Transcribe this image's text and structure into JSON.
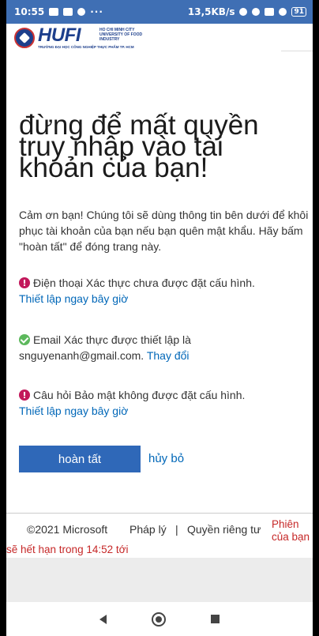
{
  "status_bar": {
    "time": "10:55",
    "overflow": "···",
    "speed": "13,5KB/s",
    "battery": "91"
  },
  "header": {
    "logo_word": "HUFI",
    "logo_side": "HO CHI MINH CITY UNIVERSITY OF FOOD INDUSTRY",
    "logo_sub": "TRƯỜNG ĐẠI HỌC CÔNG NGHIỆP THỰC PHẨM TP. HCM"
  },
  "main": {
    "title": "đừng để mất quyền truy nhập vào tài khoản của bạn!",
    "description": "Cảm ơn bạn! Chúng tôi sẽ dùng thông tin bên dưới để khôi phục tài khoản của bạn nếu bạn quên mật khẩu. Hãy bấm \"hoàn tất\" để đóng trang này.",
    "items": [
      {
        "status": "warning",
        "text": "Điện thoại Xác thực chưa được đặt cấu hình.",
        "link": "Thiết lập ngay bây giờ"
      },
      {
        "status": "ok",
        "text": "Email Xác thực được thiết lập là snguyenanh@gmail.com.",
        "link": "Thay đổi"
      },
      {
        "status": "warning",
        "text": "Câu hỏi Bảo mật không được đặt cấu hình.",
        "link": "Thiết lập ngay bây giờ"
      }
    ],
    "finish_button": "hoàn tất",
    "cancel_link": "hủy bỏ"
  },
  "footer": {
    "copyright": "©2021 Microsoft",
    "legal": "Pháp lý",
    "separator": "|",
    "privacy": "Quyền riêng tư",
    "session_a": "Phiên của bạn",
    "session_b": "sẽ hết hạn trong 14:52 tới"
  },
  "colors": {
    "accent": "#2f68b8",
    "link": "#0067b8",
    "warning": "#c2185b",
    "ok": "#5cb85c",
    "session": "#c62828"
  },
  "icons": {
    "nav_back": "back-triangle-icon",
    "nav_home": "home-circle-icon",
    "nav_recent": "recent-square-icon"
  }
}
